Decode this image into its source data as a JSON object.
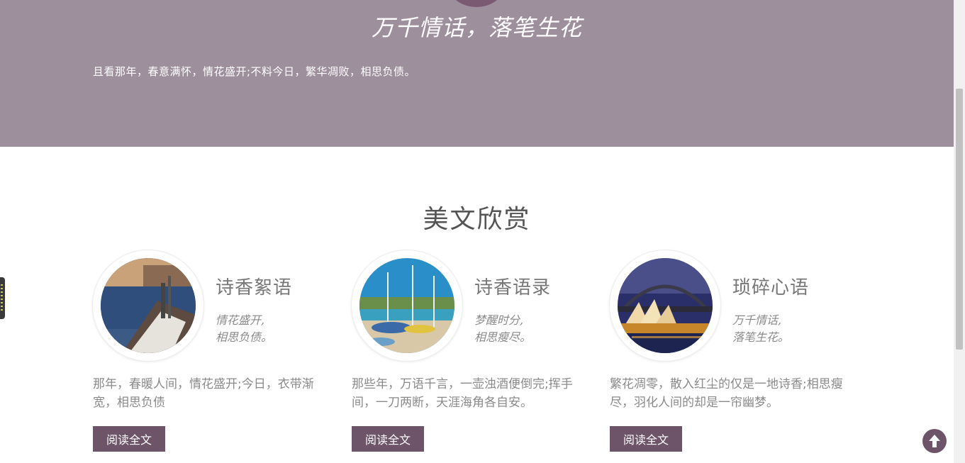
{
  "hero": {
    "title": "万千情话，落笔生花",
    "text": "且看那年，春意满怀，情花盛开;不料今日，繁华凋败，相思负债。"
  },
  "section": {
    "title": "美文欣赏"
  },
  "cards": [
    {
      "name": "诗香絮语",
      "poem_line1": "情花盛开,",
      "poem_line2": "相思负债。",
      "desc": "那年，春暖人间，情花盛开;今日，衣带渐宽，相思负债",
      "button": "阅读全文",
      "image_icon": "harbor-boat-photo"
    },
    {
      "name": "诗香语录",
      "poem_line1": "梦醒时分,",
      "poem_line2": "相思瘦尽。",
      "desc": "那些年，万语千言，一壶浊酒便倒完;挥手间，一刀两断，天涯海角各自安。",
      "button": "阅读全文",
      "image_icon": "beach-sailboat-photo"
    },
    {
      "name": "琐碎心语",
      "poem_line1": "万千情话,",
      "poem_line2": "落笔生花。",
      "desc": "繁花凋零，散入红尘的仅是一地诗香;相思瘦尽，羽化人间的却是一帘幽梦。",
      "button": "阅读全文",
      "image_icon": "opera-house-night-photo"
    }
  ],
  "colors": {
    "hero_bg": "#9e8f9c",
    "accent": "#6e5468",
    "text_muted": "#8a8a8a"
  },
  "icons": {
    "back_to_top": "arrow-up-icon"
  }
}
